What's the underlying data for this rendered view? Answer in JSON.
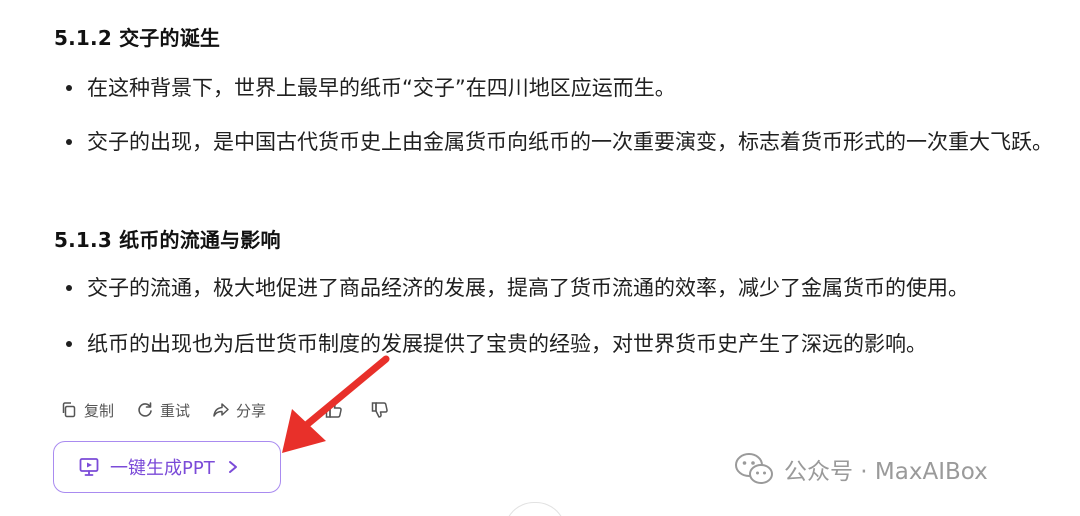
{
  "sections": [
    {
      "heading": "5.1.2 交子的诞生",
      "bullets": [
        "在这种背景下，世界上最早的纸币“交子”在四川地区应运而生。",
        "交子的出现，是中国古代货币史上由金属货币向纸币的一次重要演变，标志着货币形式的一次重大飞跃。"
      ]
    },
    {
      "heading": "5.1.3 纸币的流通与影响",
      "bullets": [
        "交子的流通，极大地促进了商品经济的发展，提高了货币流通的效率，减少了金属货币的使用。",
        "纸币的出现也为后世货币制度的发展提供了宝贵的经验，对世界货币史产生了深远的影响。"
      ]
    }
  ],
  "actions": {
    "copy": "复制",
    "retry": "重试",
    "share": "分享",
    "like_icon": "thumbs-up-icon",
    "dislike_icon": "thumbs-down-icon"
  },
  "ppt_button": {
    "label": "一键生成PPT",
    "icon": "presentation-icon"
  },
  "watermark": {
    "text": "公众号 · MaxAIBox",
    "icon": "wechat-icon"
  },
  "colors": {
    "accent": "#7b4bd8",
    "accent_border": "#a98bf0",
    "arrow": "#e8302a",
    "watermark": "#9a9a9a"
  }
}
